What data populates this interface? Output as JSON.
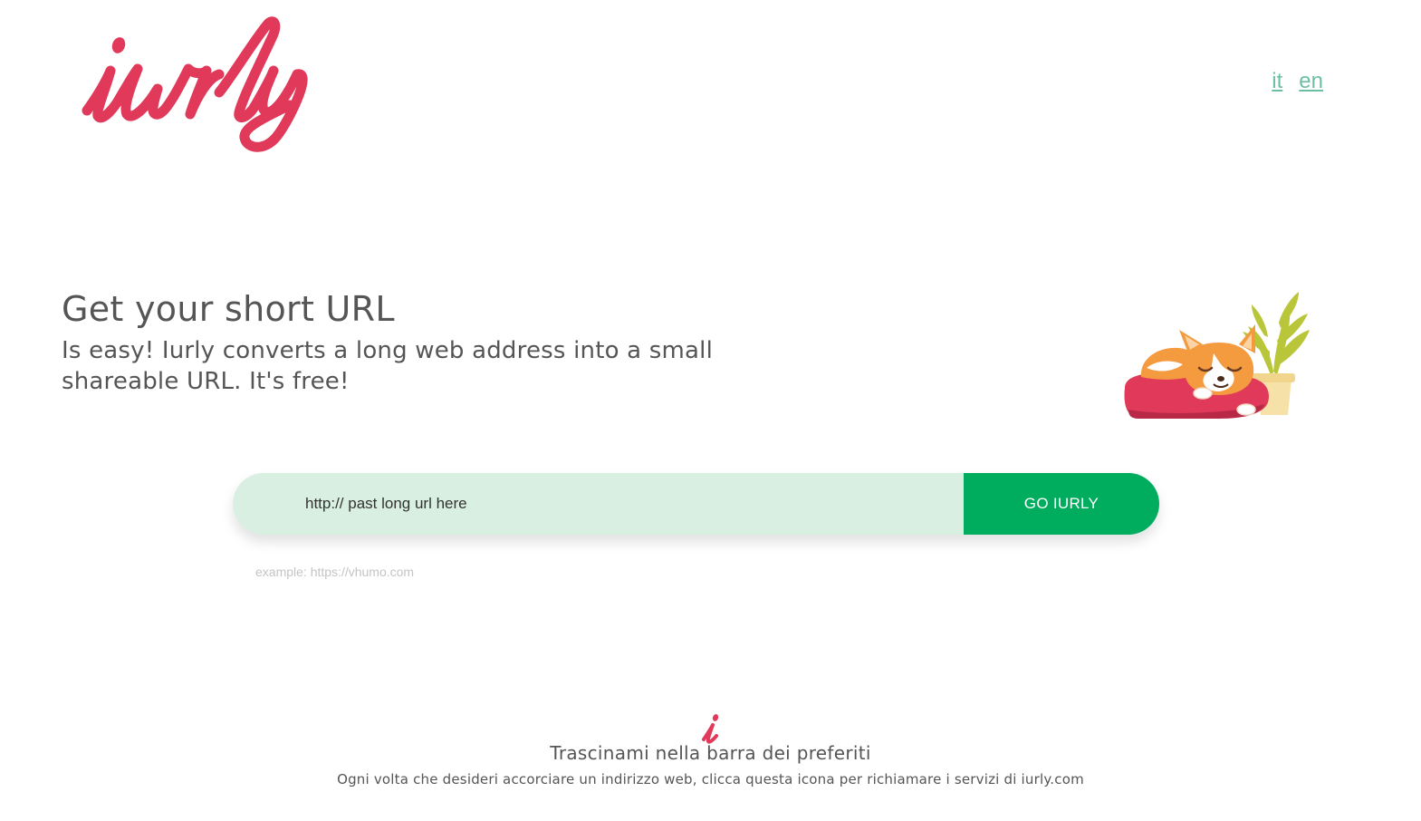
{
  "brand": {
    "logo_text": "iurly",
    "logo_icon": "iurly-logo",
    "color": "#e0395a"
  },
  "language": {
    "options": [
      "it",
      "en"
    ]
  },
  "hero": {
    "title": "Get your short URL",
    "subtitle": "Is easy! Iurly converts a long web address into a small shareable URL. It's free!"
  },
  "illustration": {
    "icon": "sleeping-corgi-illustration"
  },
  "form": {
    "url_placeholder": "http:// past long url here",
    "url_value": "",
    "submit_label": "GO IURLY",
    "example": "example: https://vhumo.com",
    "accent_color": "#00ad5f",
    "input_bg": "#d8efe2"
  },
  "bookmark": {
    "icon": "iurly-i-bookmark-icon",
    "title": "Trascinami nella barra dei preferiti",
    "description": "Ogni volta che desideri accorciare un indirizzo web, clicca questa icona per richiamare i servizi di iurly.com"
  }
}
